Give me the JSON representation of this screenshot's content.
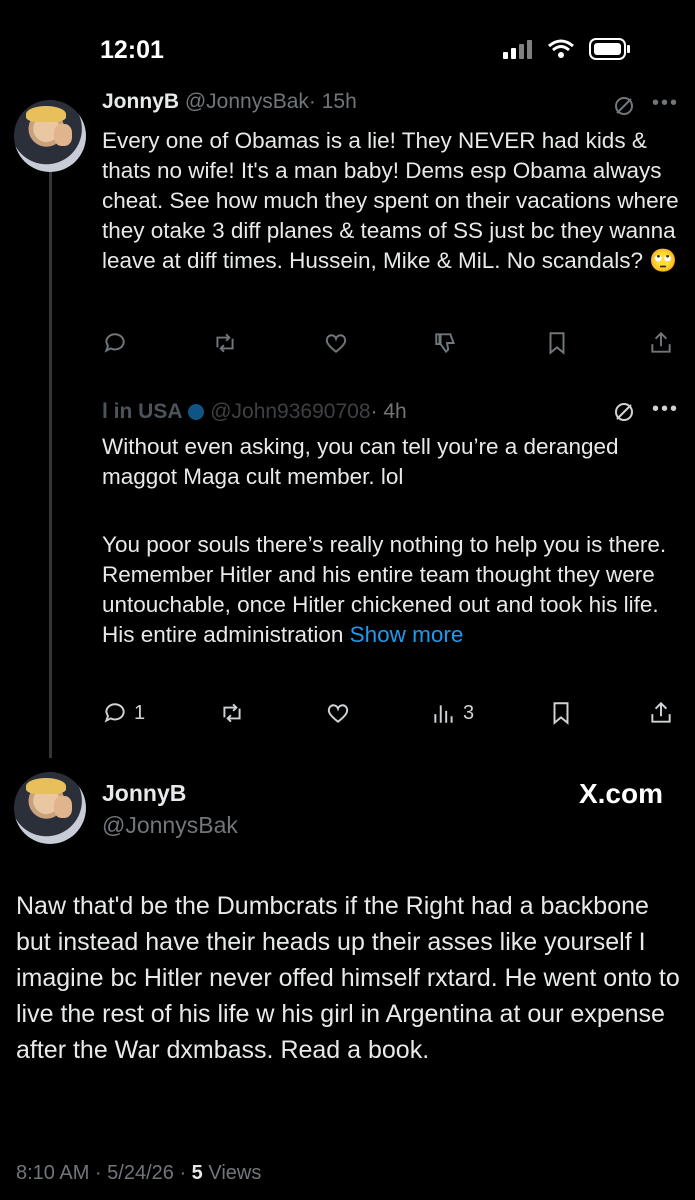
{
  "status_bar": {
    "time": "12:01",
    "signal_icon": "signal-bars-icon",
    "wifi_icon": "wifi-icon",
    "battery_icon": "battery-icon"
  },
  "tweet1": {
    "name": "JonnyB",
    "handle": "@JonnysBak",
    "time": "· 15h",
    "text": "Every one of Obamas is a lie! They NEVER had kids & thats no wife! It's a man baby! Dems esp Obama always cheat. See how much they spent on their vacations where they otake 3 diff planes & teams of SS just bc they wanna leave at diff times. Hussein, Mike & MiL. No scandals? 🙄",
    "actions": {
      "replies": "",
      "reposts": "",
      "likes": "",
      "views": ""
    }
  },
  "tweet2": {
    "name": "l in USA",
    "handle": "@John93690708",
    "time": "· 4h",
    "text_p1": "Without even asking, you can tell you’re a deranged maggot Maga cult member. lol",
    "text_p2": "You poor souls there’s really nothing to help you is there.  Remember Hitler and his entire team thought they were untouchable, once Hitler chickened out and took his life. His entire administration",
    "show_more": "Show more",
    "actions": {
      "replies": "1",
      "reposts": "",
      "likes": "",
      "views": "3"
    }
  },
  "main_tweet": {
    "name": "JonnyB",
    "handle": "@JonnysBak",
    "source": "X.com",
    "text": "Naw that'd be the Dumbcrats if the Right had a backbone but instead have their heads up their asses like yourself I imagine bc Hitler never offed himself rxtard. He went onto to live the rest of his life w his girl in Argentina at our expense after the War dxmbass. Read a book.",
    "timestamp": "8:10 AM · 5/24/26 · ",
    "views_count": "5",
    "views_label": " Views"
  },
  "colors": {
    "background": "#000000",
    "text": "#e7e9ea",
    "muted": "#71767b",
    "link": "#1d9bf0",
    "verified": "#1d9bf0"
  }
}
